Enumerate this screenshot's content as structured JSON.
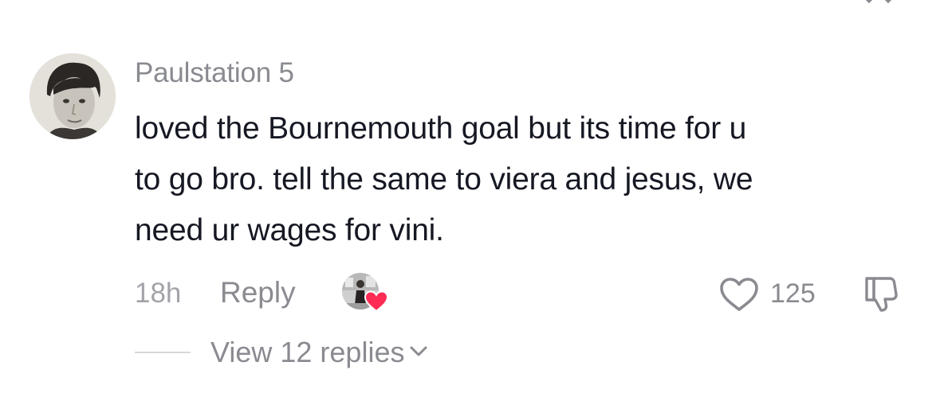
{
  "comment": {
    "username": "Paulstation 5",
    "text_lines": [
      "loved the Bournemouth goal but its time for u",
      "to go bro. tell the same to viera and jesus, we",
      "need ur wages for vini."
    ],
    "timestamp": "18h",
    "reply_label": "Reply",
    "like_count": "125",
    "view_replies_label": "View 12 replies"
  },
  "icons": {
    "like": "heart-outline-icon",
    "dislike": "thumbs-down-icon",
    "creator_liked": "creator-liked-badge",
    "expand": "chevron-down-icon"
  },
  "colors": {
    "text_primary": "#161823",
    "text_secondary": "#8a8b91",
    "creator_heart": "#fe2c55"
  }
}
